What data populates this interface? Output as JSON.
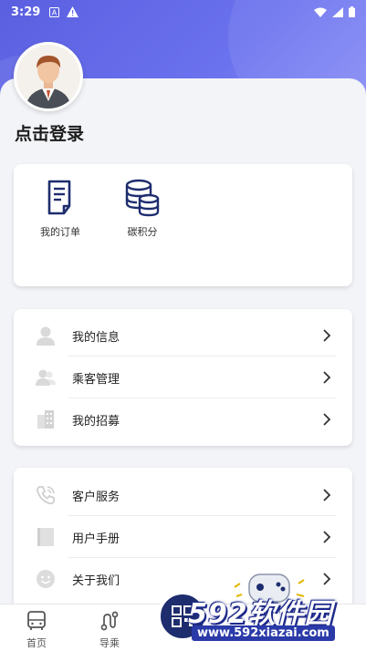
{
  "status_bar": {
    "time": "3:29"
  },
  "profile": {
    "login_text": "点击登录"
  },
  "top_card": {
    "items": [
      {
        "label": "我的订单",
        "icon": "order-icon"
      },
      {
        "label": "碳积分",
        "icon": "carbon-points-icon"
      }
    ]
  },
  "list1": {
    "items": [
      {
        "label": "我的信息",
        "icon": "user-icon"
      },
      {
        "label": "乘客管理",
        "icon": "passengers-icon"
      },
      {
        "label": "我的招募",
        "icon": "building-icon"
      }
    ]
  },
  "list2": {
    "items": [
      {
        "label": "客户服务",
        "icon": "phone-icon"
      },
      {
        "label": "用户手册",
        "icon": "manual-icon"
      },
      {
        "label": "关于我们",
        "icon": "smile-icon"
      }
    ]
  },
  "bottom_nav": {
    "items": [
      {
        "label": "首页",
        "icon": "bus-icon"
      },
      {
        "label": "导乘",
        "icon": "route-icon"
      }
    ]
  },
  "watermark": {
    "main": "592软件园",
    "sub": "www.592xiazai.com"
  },
  "colors": {
    "header": "#6268e8",
    "accent": "#1e2d6e"
  }
}
